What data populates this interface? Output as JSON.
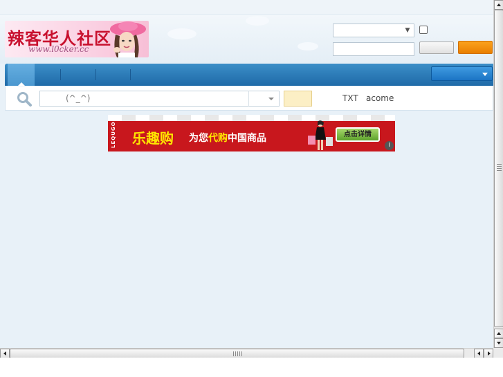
{
  "header": {
    "logo": {
      "title": "辣客华人社区",
      "url_text": "www.l0cker.cc",
      "icon": "logo-portrait-image"
    },
    "login": {
      "username_value": "",
      "password_value": "",
      "remember_checked": false,
      "register_label": "",
      "login_label": "",
      "accent_color": "#f08a0a"
    }
  },
  "nav": {
    "items": [
      "",
      "",
      "",
      ""
    ],
    "active_index": 0,
    "dropdown_label": "",
    "color": "#2a7bbd"
  },
  "search": {
    "icon": "search-icon",
    "input_text": "(^_^)",
    "type_value": "",
    "button_label": "",
    "hot_words": [
      "TXT",
      "acome"
    ]
  },
  "banner": {
    "brand": "LEQUGO",
    "main_text": "乐趣购",
    "sub_text_prefix": "为您",
    "sub_text_highlight": "代购",
    "sub_text_suffix": "中国商品",
    "button_label": "点击详情",
    "info_icon": "i",
    "background_color": "#c8171d"
  },
  "scrollbars": {
    "vertical": {
      "icons": [
        "arrow-up-icon",
        "arrow-down-icon"
      ]
    },
    "horizontal": {
      "icons": [
        "arrow-left-icon",
        "arrow-right-icon"
      ]
    }
  }
}
